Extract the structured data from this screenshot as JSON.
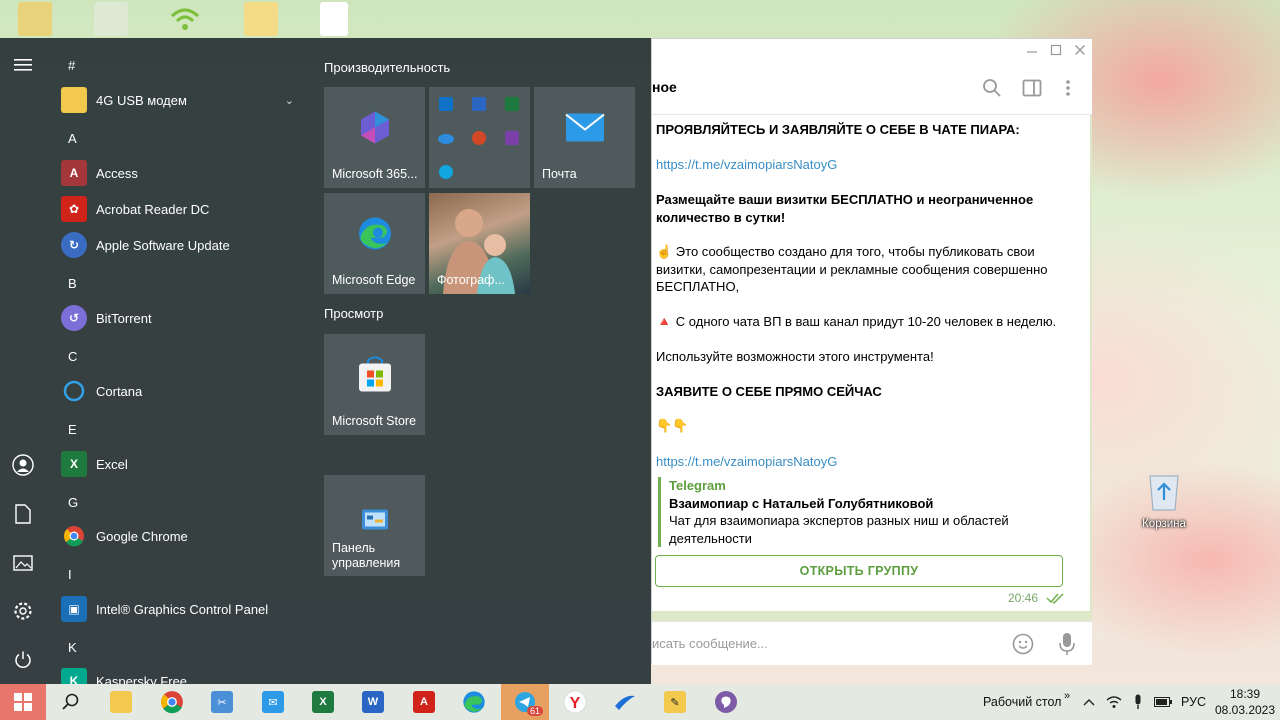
{
  "start_menu": {
    "groups": {
      "productivity": "Производительность",
      "browse": "Просмотр"
    },
    "app_list": [
      {
        "type": "letter",
        "text": "#"
      },
      {
        "type": "app",
        "label": "4G USB модем",
        "icon": "folder-icon",
        "color": "#f2c94c",
        "expandable": true
      },
      {
        "type": "letter",
        "text": "A"
      },
      {
        "type": "app",
        "label": "Access",
        "icon": "access-icon",
        "color": "#a4373a"
      },
      {
        "type": "app",
        "label": "Acrobat Reader DC",
        "icon": "acrobat-icon",
        "color": "#d0231a"
      },
      {
        "type": "app",
        "label": "Apple Software Update",
        "icon": "apple-update-icon",
        "color": "#3b6cc4"
      },
      {
        "type": "letter",
        "text": "B"
      },
      {
        "type": "app",
        "label": "BitTorrent",
        "icon": "bittorrent-icon",
        "color": "#7c6fd8"
      },
      {
        "type": "letter",
        "text": "C"
      },
      {
        "type": "app",
        "label": "Cortana",
        "icon": "cortana-icon",
        "color": "#33a1e8"
      },
      {
        "type": "letter",
        "text": "E"
      },
      {
        "type": "app",
        "label": "Excel",
        "icon": "excel-icon",
        "color": "#1f7a3f"
      },
      {
        "type": "letter",
        "text": "G"
      },
      {
        "type": "app",
        "label": "Google Chrome",
        "icon": "chrome-icon",
        "color": "#db4437"
      },
      {
        "type": "letter",
        "text": "I"
      },
      {
        "type": "app",
        "label": "Intel® Graphics Control Panel",
        "icon": "intel-icon",
        "color": "#1b6fb7"
      },
      {
        "type": "letter",
        "text": "K"
      },
      {
        "type": "app",
        "label": "Kaspersky Free",
        "icon": "kaspersky-icon",
        "color": "#00a88e"
      }
    ],
    "tiles": {
      "m365": "Microsoft 365...",
      "mail": "Почта",
      "edge": "Microsoft Edge",
      "photos": "Фотограф...",
      "store": "Microsoft Store",
      "control_panel": "Панель управления"
    }
  },
  "telegram": {
    "chat_title_fragment": "ное",
    "message": {
      "line1": "ПРОЯВЛЯЙТЕСЬ И ЗАЯВЛЯЙТЕ О СЕБЕ В ЧАТЕ ПИАРА:",
      "link1": "https://t.me/vzaimopiarsNatoyG",
      "line2": "Размещайте ваши визитки БЕСПЛАТНО и неограниченное количество в сутки!",
      "line3": "☝️ Это сообщество создано для того, чтобы публиковать свои визитки, самопрезентации и рекламные сообщения совершенно БЕСПЛАТНО,",
      "line4": "🔺 С одного чата ВП в ваш канал придут 10-20 человек в неделю.",
      "line5": "Используйте возможности этого инструмента!",
      "line6": "ЗАЯВИТЕ О СЕБЕ ПРЯМО СЕЙЧАС",
      "emoji": "👇👇",
      "link2": "https://t.me/vzaimopiarsNatoyG"
    },
    "preview": {
      "site": "Telegram",
      "title": "Взаимопиар с Натальей Голубятниковой",
      "desc": "Чат для взаимопиара экспертов разных ниш и областей деятельности"
    },
    "open_button": "ОТКРЫТЬ ГРУППУ",
    "time": "20:46",
    "input_placeholder": "исать сообщение..."
  },
  "desktop": {
    "recycle_bin_label": "Корзина"
  },
  "taskbar": {
    "telegram_badge": "61",
    "desktop_label": "Рабочий стол",
    "language": "РУС",
    "time": "18:39",
    "date": "08.03.2023"
  }
}
